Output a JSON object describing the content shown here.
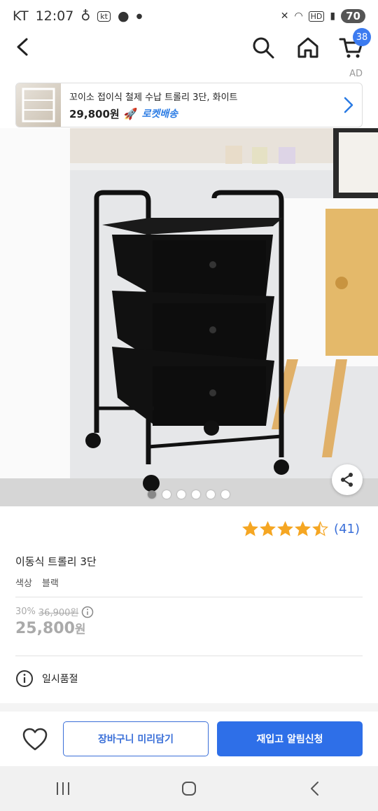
{
  "status_bar": {
    "carrier": "KT",
    "time": "12:07",
    "network": "HD",
    "battery": "70"
  },
  "header": {
    "cart_count": "38"
  },
  "ad": {
    "label": "AD",
    "title": "꼬이소 접이식 철제 수납 트롤리 3단, 화이트",
    "price": "29,800원",
    "delivery": "로켓배송"
  },
  "product": {
    "rating": 4.5,
    "review_count": "(41)",
    "name": "이동식 트롤리 3단",
    "option_label": "색상",
    "option_value": "블랙",
    "discount_rate": "30%",
    "original_price": "36,900원",
    "sale_price": "25,800",
    "sale_price_unit": "원",
    "status": "일시품절"
  },
  "gallery": {
    "image_count": 6,
    "active_index": 0
  },
  "actions": {
    "cart_button": "장바구니 미리담기",
    "restock_button": "재입고 알림신청"
  },
  "colors": {
    "accent": "#2e6fe8",
    "star": "#f5a623",
    "review_link": "#3a6fd8"
  }
}
